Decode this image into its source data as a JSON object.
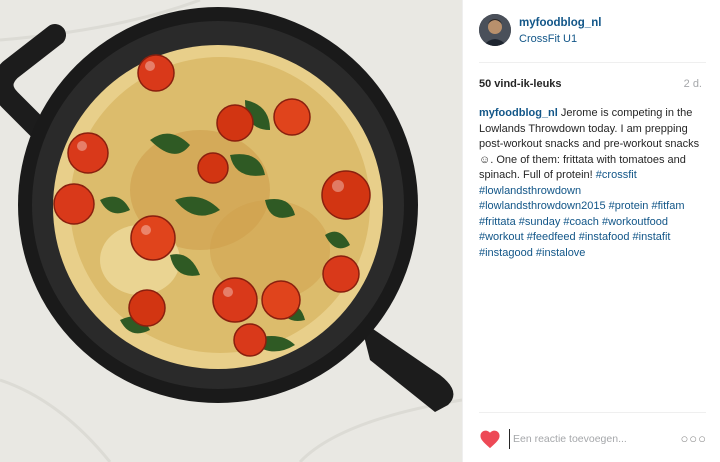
{
  "post": {
    "author": "myfoodblog_nl",
    "location": "CrossFit U1",
    "likes": "50 vind-ik-leuks",
    "time_ago": "2 d.",
    "caption_author": "myfoodblog_nl",
    "caption_text": " Jerome is competing in the Lowlands Throwdown today. I am prepping post-workout snacks and pre-workout snacks ☺. One of them: frittata with tomatoes and spinach. Full of protein!",
    "hashtags": [
      "#crossfit",
      "#lowlandsthrowdown",
      "#lowlandsthrowdown2015",
      "#protein",
      "#fitfam",
      "#frittata",
      "#sunday",
      "#coach",
      "#workoutfood",
      "#workout",
      "#feedfeed",
      "#instafood",
      "#instafit",
      "#instagood",
      "#instalove"
    ]
  },
  "footer": {
    "comment_placeholder": "Een reactie toevoegen...",
    "more_label": "○○○"
  },
  "photo": {
    "subject": "frittata with cherry tomatoes and spinach in cast-iron skillet"
  },
  "colors": {
    "link": "#125688",
    "heart": "#ed4956"
  },
  "icons": [
    "like-heart-icon",
    "more-options-icon",
    "avatar"
  ]
}
